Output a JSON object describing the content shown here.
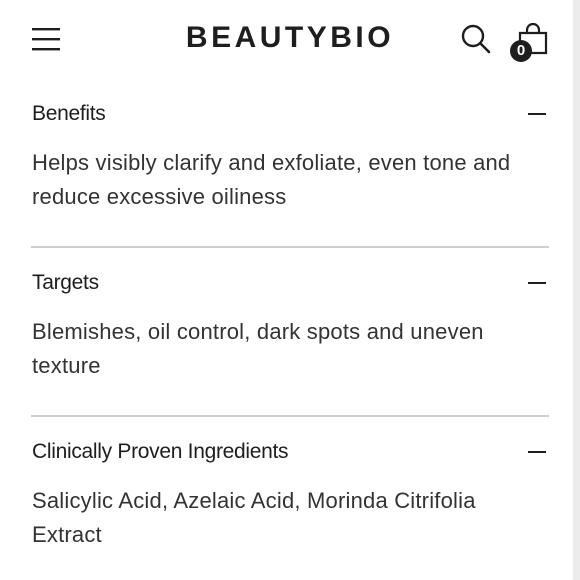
{
  "header": {
    "brand": "BEAUTYBIO",
    "cart_count": "0",
    "icons": [
      "hamburger-menu-icon",
      "search-icon",
      "shopping-bag-icon"
    ]
  },
  "accordion": [
    {
      "title": "Benefits",
      "body": "Helps visibly clarify and exfoliate, even tone and reduce excessive oiliness",
      "expanded": true
    },
    {
      "title": "Targets",
      "body": "Blemishes, oil control, dark spots and uneven texture",
      "expanded": true
    },
    {
      "title": "Clinically Proven Ingredients",
      "body": "Salicylic Acid, Azelaic Acid, Morinda Citrifolia Extract",
      "expanded": true
    }
  ],
  "colors": {
    "text": "#1e1e1e",
    "body_text": "#333333",
    "divider": "#cfcfcf",
    "background": "#ffffff"
  }
}
